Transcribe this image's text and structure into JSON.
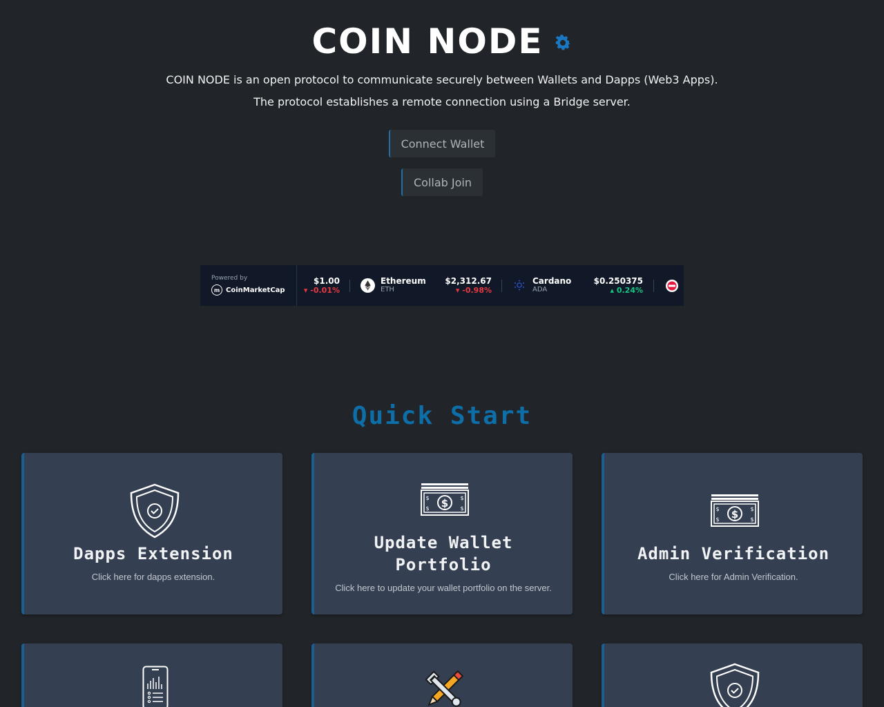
{
  "header": {
    "title": "COIN NODE",
    "description_line1": "COIN NODE is an open protocol to communicate securely between Wallets and Dapps (Web3 Apps).",
    "description_line2": "The protocol establishes a remote connection using a Bridge server."
  },
  "buttons": {
    "connect_wallet": "Connect Wallet",
    "collab_join": "Collab Join"
  },
  "ticker": {
    "powered_by": "Powered by",
    "provider": "CoinMarketCap",
    "items": [
      {
        "name": "",
        "symbol": "",
        "price": "$1.00",
        "change": "-0.01%",
        "direction": "down"
      },
      {
        "name": "Ethereum",
        "symbol": "ETH",
        "price": "$2,312.67",
        "change": "-0.98%",
        "direction": "down"
      },
      {
        "name": "Cardano",
        "symbol": "ADA",
        "price": "$0.250375",
        "change": "0.24%",
        "direction": "up"
      }
    ]
  },
  "quick_start": {
    "title": "Quick Start",
    "cards": [
      {
        "title": "Dapps Extension",
        "subtitle": "Click here for dapps extension.",
        "icon": "shield-check-icon"
      },
      {
        "title_line1": "Update Wallet",
        "title_line2": "Portfolio",
        "subtitle": "Click here to update your wallet portfolio on the server.",
        "icon": "money-bill-icon"
      },
      {
        "title": "Admin Verification",
        "subtitle": "Click here for Admin Verification.",
        "icon": "money-bill-icon"
      },
      {
        "icon": "mobile-phone-icon"
      },
      {
        "icon": "wrench-pencil-icon"
      },
      {
        "icon": "shield-check-icon"
      }
    ]
  },
  "colors": {
    "background": "#212529",
    "card": "#343f51",
    "accent": "#0d6ea8",
    "ticker_bg": "#111827",
    "down": "#ea3943",
    "up": "#16c784"
  }
}
